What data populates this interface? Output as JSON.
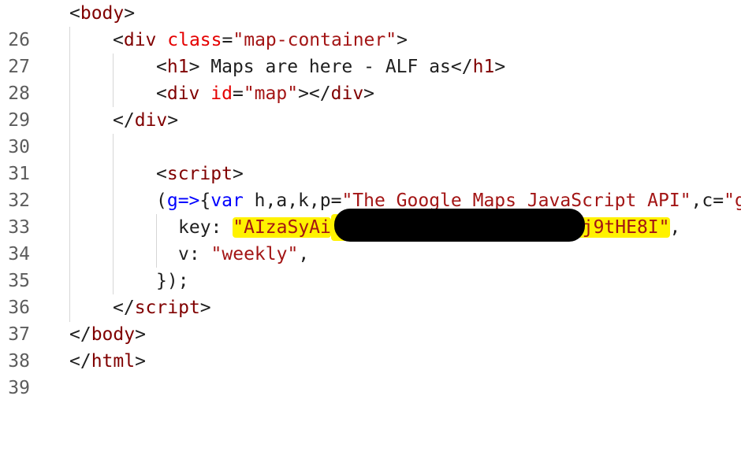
{
  "lines": [
    {
      "number": "26",
      "tokens": [
        "<",
        "body",
        ">"
      ]
    },
    {
      "number": "27",
      "tokens": [
        "<",
        "div",
        " ",
        "class",
        "=",
        "\"map-container\"",
        ">"
      ]
    },
    {
      "number": "28",
      "tokens": [
        "<",
        "h1",
        ">",
        " Maps are here - ALF as",
        "</",
        "h1",
        ">"
      ]
    },
    {
      "number": "29",
      "tokens": [
        "<",
        "div",
        " ",
        "id",
        "=",
        "\"map\"",
        "></",
        "div",
        ">"
      ]
    },
    {
      "number": "30",
      "tokens": [
        "</",
        "div",
        ">"
      ]
    },
    {
      "number": "31",
      "tokens": []
    },
    {
      "number": "32",
      "tokens": [
        "<",
        "script",
        ">"
      ]
    },
    {
      "number": "33",
      "tokens": [
        "(",
        "g=>",
        "{",
        "var",
        " h,a,k,p=",
        "\"The Google Maps JavaScript API\"",
        ",c=",
        "\"g"
      ]
    },
    {
      "number": "34",
      "tokens": [
        "key: ",
        "\"AIzaSyAi",
        "wj9tHE8I\"",
        ","
      ]
    },
    {
      "number": "35",
      "tokens": [
        "v: ",
        "\"weekly\"",
        ","
      ]
    },
    {
      "number": "36",
      "tokens": [
        "});"
      ]
    },
    {
      "number": "37",
      "tokens": [
        "</",
        "script",
        ">"
      ]
    },
    {
      "number": "38",
      "tokens": [
        "</",
        "body",
        ">"
      ]
    },
    {
      "number": "39",
      "tokens": [
        "</",
        "html",
        ">"
      ]
    }
  ],
  "colors": {
    "tag": "#800000",
    "attribute": "#e50000",
    "string": "#a31515",
    "keyword": "#0000ff",
    "highlight": "#fff200",
    "redaction": "#000000"
  }
}
